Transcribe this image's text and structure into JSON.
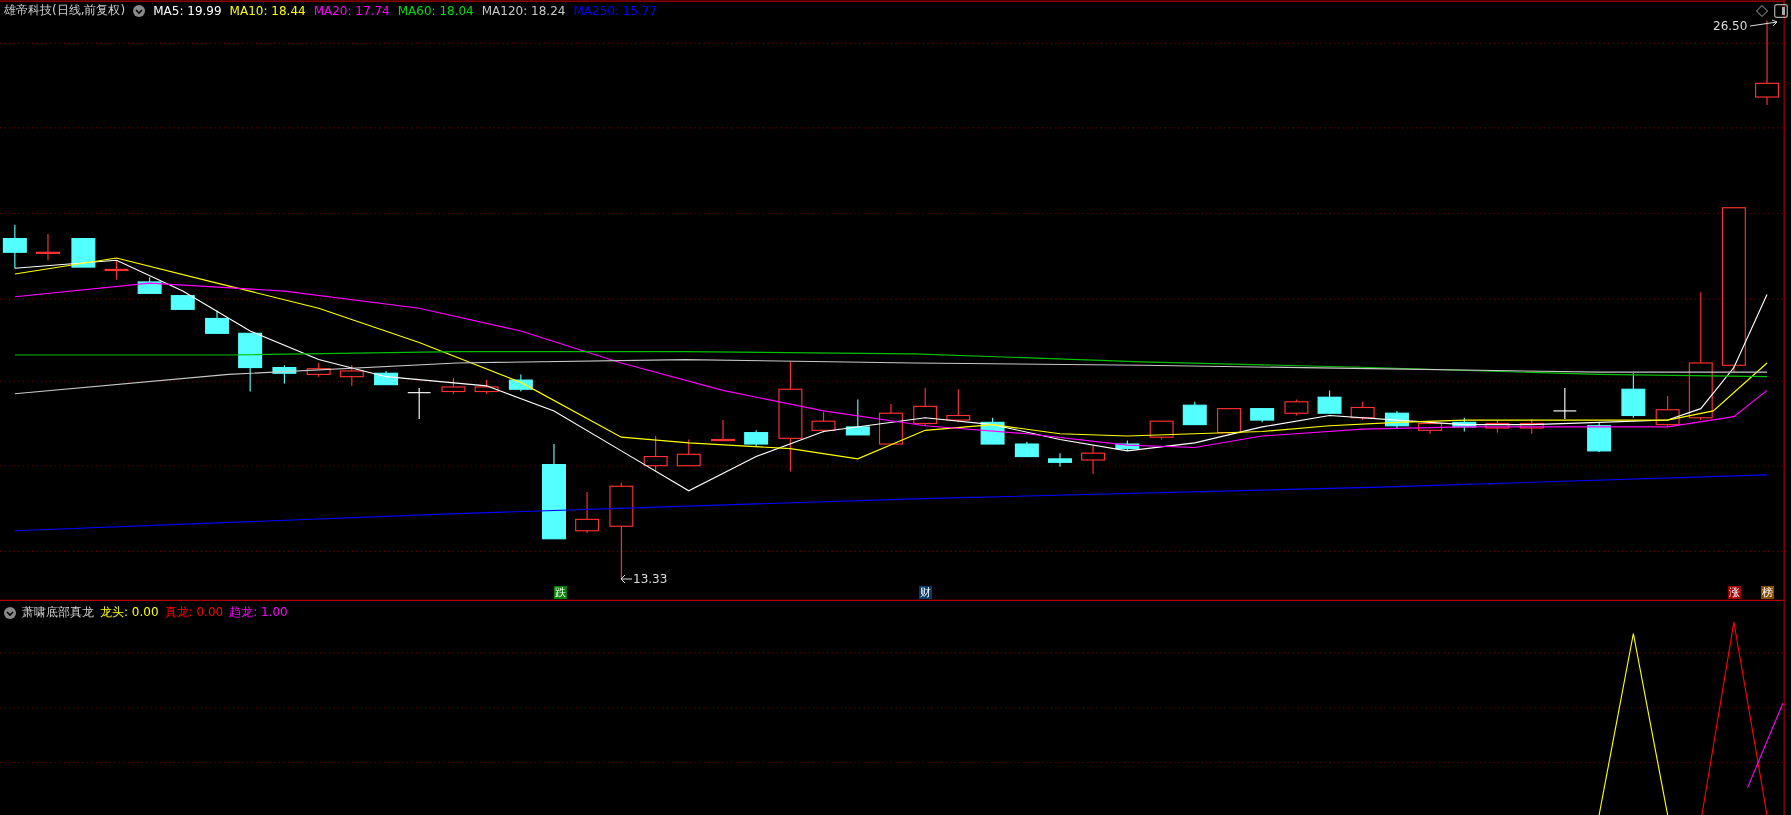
{
  "main_chart": {
    "stock_name": "雄帝科技(日线,前复权)",
    "ma_legend": [
      {
        "label": "MA5: 19.99",
        "color": "#ffffff"
      },
      {
        "label": "MA10: 18.44",
        "color": "#ffff00"
      },
      {
        "label": "MA20: 17.74",
        "color": "#ff00ff"
      },
      {
        "label": "MA60: 18.04",
        "color": "#00e000"
      },
      {
        "label": "MA120: 18.24",
        "color": "#c8c8c8"
      },
      {
        "label": "MA250: 15.77",
        "color": "#0000ff"
      }
    ],
    "high_label": "26.50",
    "low_label": "13.33",
    "markers": [
      {
        "text": "跌",
        "color": "#008000"
      },
      {
        "text": "财",
        "color": "#0a3a6a"
      },
      {
        "text": "涨",
        "color": "#a00000"
      },
      {
        "text": "榜",
        "color": "#8b4a00"
      }
    ]
  },
  "indicator": {
    "name": "萧啸底部真龙",
    "values": [
      {
        "label": "龙头: 0.00",
        "color": "#ffff00"
      },
      {
        "label": "真龙: 0.00",
        "color": "#ff0000"
      },
      {
        "label": "趋龙: 1.00",
        "color": "#ff00ff"
      }
    ]
  }
}
